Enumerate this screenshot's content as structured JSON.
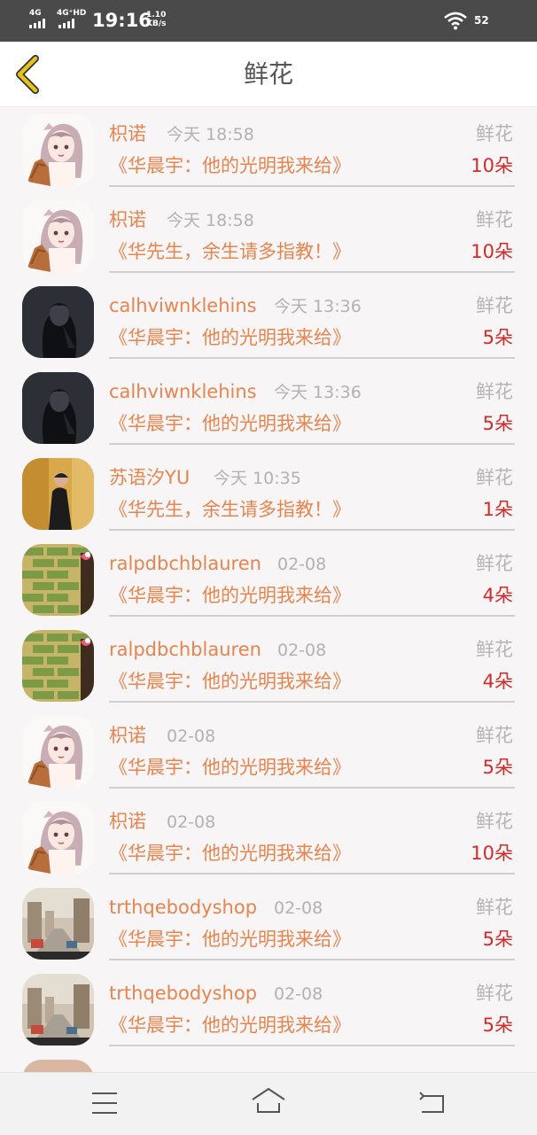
{
  "status_bar": {
    "network_1": "4G",
    "network_2": "4G⁺HD",
    "time": "19:16",
    "speed_value": "1.10",
    "speed_unit": "KB/s",
    "battery": "52",
    "wifi_icon": "wifi-icon"
  },
  "header": {
    "title": "鲜花",
    "back_icon": "chevron-left-icon"
  },
  "colors": {
    "accent": "#e8844d",
    "count": "#d52a2a",
    "back_arrow": "#e6c319"
  },
  "records": [
    {
      "user": "枳诺",
      "time": "今天 18:58",
      "gift": "鲜花",
      "book": "《华晨宇：他的光明我来给》",
      "count": "10朵"
    },
    {
      "user": "枳诺",
      "time": "今天 18:58",
      "gift": "鲜花",
      "book": "《华先生，余生请多指教！》",
      "count": "10朵"
    },
    {
      "user": "calhviwnklehins",
      "time": "今天 13:36",
      "gift": "鲜花",
      "book": "《华晨宇：他的光明我来给》",
      "count": "5朵"
    },
    {
      "user": "calhviwnklehins",
      "time": "今天 13:36",
      "gift": "鲜花",
      "book": "《华晨宇：他的光明我来给》",
      "count": "5朵"
    },
    {
      "user": "苏语汐YU",
      "time": "今天 10:35",
      "gift": "鲜花",
      "book": "《华先生，余生请多指教！》",
      "count": "1朵"
    },
    {
      "user": "ralpdbchblauren",
      "time": "02-08",
      "gift": "鲜花",
      "book": "《华晨宇：他的光明我来给》",
      "count": "4朵"
    },
    {
      "user": "ralpdbchblauren",
      "time": "02-08",
      "gift": "鲜花",
      "book": "《华晨宇：他的光明我来给》",
      "count": "4朵"
    },
    {
      "user": "枳诺",
      "time": "02-08",
      "gift": "鲜花",
      "book": "《华晨宇：他的光明我来给》",
      "count": "5朵"
    },
    {
      "user": "枳诺",
      "time": "02-08",
      "gift": "鲜花",
      "book": "《华晨宇：他的光明我来给》",
      "count": "10朵"
    },
    {
      "user": "trthqebodyshop",
      "time": "02-08",
      "gift": "鲜花",
      "book": "《华晨宇：他的光明我来给》",
      "count": "5朵"
    },
    {
      "user": "trthqebodyshop",
      "time": "02-08",
      "gift": "鲜花",
      "book": "《华晨宇：他的光明我来给》",
      "count": "5朵"
    }
  ],
  "nav_bar": {
    "menu_icon": "menu-icon",
    "home_icon": "home-icon",
    "back_icon": "back-icon"
  }
}
